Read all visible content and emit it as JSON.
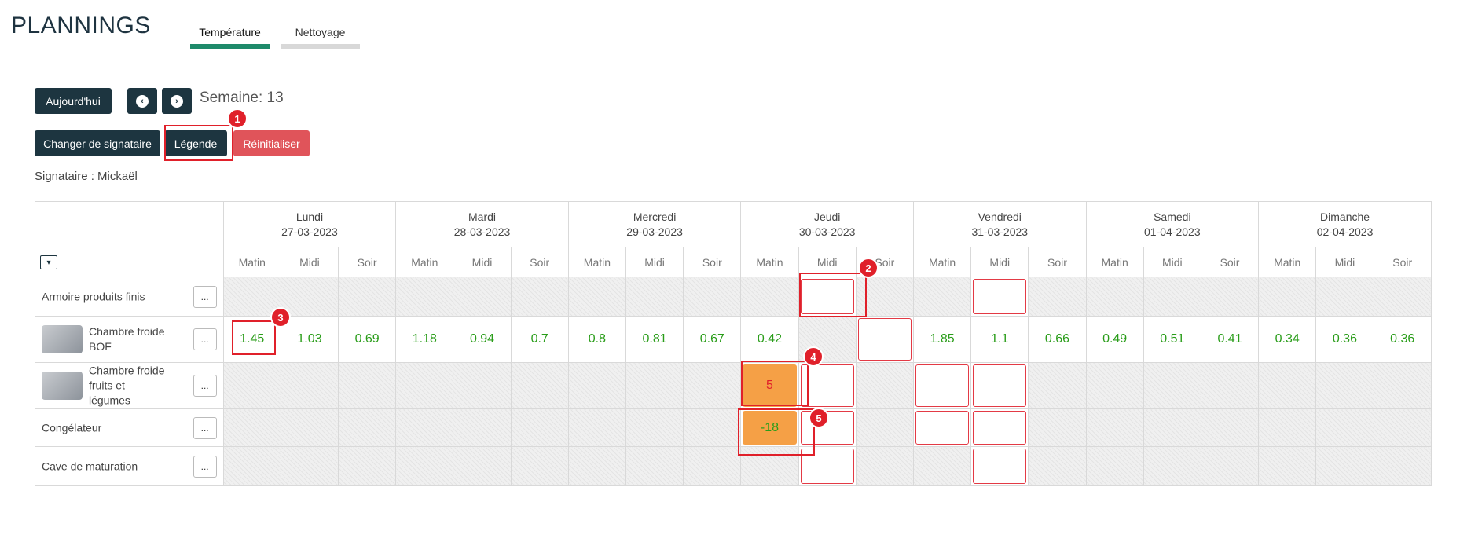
{
  "page_title": "PLANNINGS",
  "tabs": [
    {
      "label": "Température",
      "active": true
    },
    {
      "label": "Nettoyage",
      "active": false
    }
  ],
  "toolbar": {
    "today_label": "Aujourd'hui",
    "prev_icon": "chevron-left-icon",
    "next_icon": "chevron-right-icon",
    "week_label": "Semaine: 13",
    "change_signer_label": "Changer de signataire",
    "legend_label": "Légende",
    "reset_label": "Réinitialiser"
  },
  "signataire_label": "Signataire : Mickaël",
  "days": [
    {
      "name": "Lundi",
      "date": "27-03-2023"
    },
    {
      "name": "Mardi",
      "date": "28-03-2023"
    },
    {
      "name": "Mercredi",
      "date": "29-03-2023"
    },
    {
      "name": "Jeudi",
      "date": "30-03-2023"
    },
    {
      "name": "Vendredi",
      "date": "31-03-2023"
    },
    {
      "name": "Samedi",
      "date": "01-04-2023"
    },
    {
      "name": "Dimanche",
      "date": "02-04-2023"
    }
  ],
  "periods": [
    "Matin",
    "Midi",
    "Soir"
  ],
  "rows": [
    {
      "name": "Armoire produits finis",
      "has_image": false,
      "more_label": "...",
      "cells": [
        "",
        "",
        "",
        "",
        "",
        "",
        "",
        "",
        "",
        "",
        "",
        "",
        "",
        "",
        "",
        "",
        "",
        "",
        "",
        "",
        ""
      ]
    },
    {
      "name": "Chambre froide BOF",
      "has_image": true,
      "more_label": "...",
      "cells": [
        "1.45",
        "1.03",
        "0.69",
        "1.18",
        "0.94",
        "0.7",
        "0.8",
        "0.81",
        "0.67",
        "0.42",
        "",
        "",
        "1.85",
        "1.1",
        "0.66",
        "0.49",
        "0.51",
        "0.41",
        "0.34",
        "0.36",
        "0.36"
      ]
    },
    {
      "name": "Chambre froide fruits et légumes",
      "has_image": true,
      "more_label": "...",
      "cells": [
        "",
        "",
        "",
        "",
        "",
        "",
        "",
        "",
        "",
        "5",
        "",
        "",
        "",
        "",
        "",
        "",
        "",
        "",
        "",
        "",
        ""
      ]
    },
    {
      "name": "Congélateur",
      "has_image": false,
      "more_label": "...",
      "cells": [
        "",
        "",
        "",
        "",
        "",
        "",
        "",
        "",
        "",
        "-18",
        "",
        "",
        "",
        "",
        "",
        "",
        "",
        "",
        "",
        "",
        ""
      ]
    },
    {
      "name": "Cave de maturation",
      "has_image": false,
      "more_label": "...",
      "cells": [
        "",
        "",
        "",
        "",
        "",
        "",
        "",
        "",
        "",
        "",
        "",
        "",
        "",
        "",
        "",
        "",
        "",
        "",
        "",
        "",
        ""
      ]
    }
  ],
  "status": {
    "value_color": "#2a9d1a",
    "alert_color": "#e0202a",
    "out_of_range_fill": "#f5a046",
    "alert_value_color": "#e0202a",
    "warn_value_color": "#2a9d1a"
  },
  "callouts": [
    "1",
    "2",
    "3",
    "4",
    "5"
  ]
}
